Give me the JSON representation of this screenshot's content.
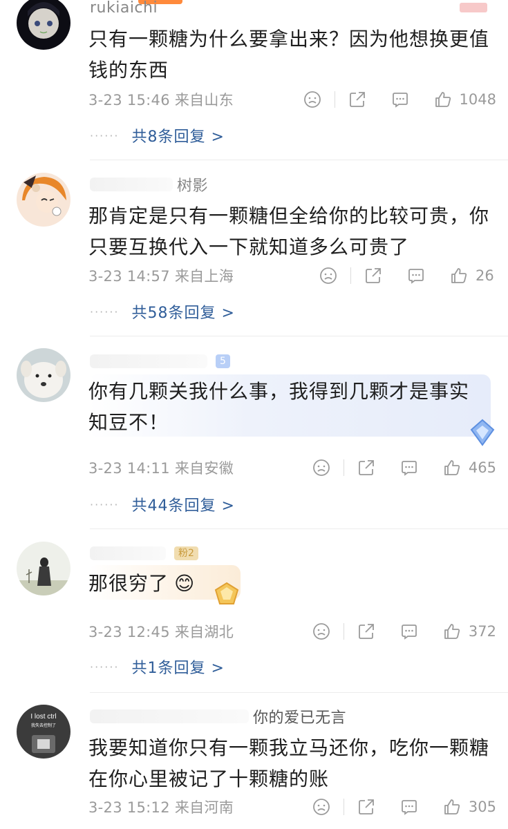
{
  "colors": {
    "link": "#2f5d99",
    "meta": "#9a9a9a",
    "text": "#1f1f1f",
    "accent": "#ff8a3c"
  },
  "comments": [
    {
      "username": "rukiaichi",
      "text_line1": "只有一颗糖为什么要拿出来？因为他想换更值",
      "text_line2": "钱的东西",
      "meta": "3-23 15:46  来自山东",
      "likes": "1048",
      "reply_link": "共8条回复 >"
    },
    {
      "username_partial": "树影",
      "text_line1": "那肯定是只有一颗糖但全给你的比较可贵，你",
      "text_line2": "只要互换代入一下就知道多么可贵了",
      "meta": "3-23 14:57  来自上海",
      "likes": "26",
      "reply_link": "共58条回复 >"
    },
    {
      "level": "5",
      "text_line1": "你有几颗关我什么事，我得到几颗才是事实",
      "text_line2": "知豆不！",
      "meta": "3-23 14:11  来自安徽",
      "likes": "465",
      "reply_link": "共44条回复 >"
    },
    {
      "level": "粉2",
      "text_line1": "那很穷了",
      "emoji": "😊",
      "meta": "3-23 12:45  来自湖北",
      "likes": "372",
      "reply_link": "共1条回复 >"
    },
    {
      "username_partial": "你的爱已无言",
      "avatar_text1": "I lost ctrl",
      "avatar_text2": "我失去控制了",
      "text_line1": "我要知道你只有一颗我立马还你，吃你一颗糖",
      "text_line2": "在你心里被记了十颗糖的账",
      "meta": "3-23 15:12  来自河南",
      "likes": "305"
    }
  ],
  "icons": [
    "dislike-icon",
    "share-icon",
    "comment-icon",
    "like-icon"
  ]
}
